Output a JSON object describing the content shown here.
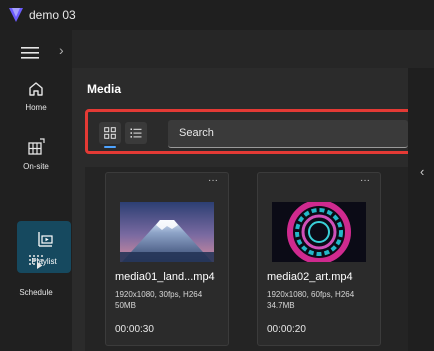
{
  "app": {
    "title": "demo 03"
  },
  "nav": {
    "items": [
      {
        "label": "Home",
        "icon": "home-icon"
      },
      {
        "label": "On-site",
        "icon": "onsite-icon"
      },
      {
        "label": "Playlist",
        "icon": "playlist-icon",
        "active": true
      },
      {
        "label": "Schedule",
        "icon": "schedule-icon"
      }
    ]
  },
  "media": {
    "title": "Media",
    "search_placeholder": "Search",
    "items": [
      {
        "name": "media01_land...mp4",
        "meta1": "1920x1080, 30fps, H264",
        "meta2": "50MB",
        "duration": "00:00:30"
      },
      {
        "name": "media02_art.mp4",
        "meta1": "1920x1080, 60fps, H264",
        "meta2": "34.7MB",
        "duration": "00:00:20"
      }
    ]
  },
  "colors": {
    "accent": "#4da3ff",
    "highlight": "#e43a35",
    "active_nav": "#16495f"
  }
}
